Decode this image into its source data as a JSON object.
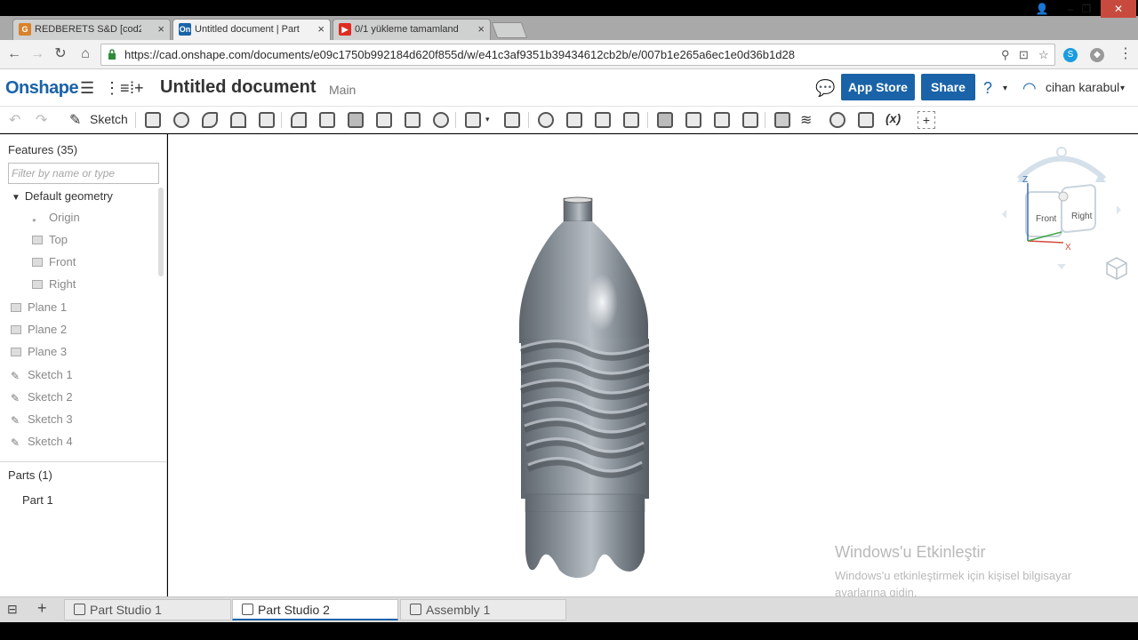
{
  "browser": {
    "tabs": [
      {
        "title": "REDBERETS S&D [cod2]",
        "favicon": "cod-icon",
        "active": false
      },
      {
        "title": "Untitled document | Part",
        "favicon": "onshape-icon",
        "active": true
      },
      {
        "title": "0/1 yükleme tamamland",
        "favicon": "youtube-icon",
        "active": false
      }
    ],
    "favicon_text": {
      "onshape": "On",
      "cod": "G"
    },
    "url": "https://cad.onshape.com/documents/e09c1750b992184d620f855d/w/e41c3af9351b39434612cb2b/e/007b1e265a6ec1e0d36b1d28"
  },
  "header": {
    "logo": "Onshape",
    "title": "Untitled document",
    "workspace": "Main",
    "app_store_label": "App Store",
    "share_label": "Share",
    "user": "cihan karabul"
  },
  "toolbar": {
    "sketch_label": "Sketch"
  },
  "features": {
    "title": "Features (35)",
    "filter_placeholder": "Filter by name or type",
    "default_geometry": "Default geometry",
    "default_items": [
      "Origin",
      "Top",
      "Front",
      "Right"
    ],
    "items": [
      "Plane 1",
      "Plane 2",
      "Plane 3",
      "Sketch 1",
      "Sketch 2",
      "Sketch 3",
      "Sketch 4"
    ]
  },
  "parts": {
    "title": "Parts (1)",
    "items": [
      "Part 1"
    ]
  },
  "viewcube": {
    "front": "Front",
    "right": "Right",
    "z": "Z",
    "x": "X"
  },
  "watermark": {
    "title": "Windows'u Etkinleştir",
    "text": "Windows'u etkinleştirmek için kişisel bilgisayar ayarlarına gidin."
  },
  "bottom_tabs": [
    {
      "label": "Part Studio 1",
      "active": false
    },
    {
      "label": "Part Studio 2",
      "active": true
    },
    {
      "label": "Assembly 1",
      "active": false
    }
  ]
}
